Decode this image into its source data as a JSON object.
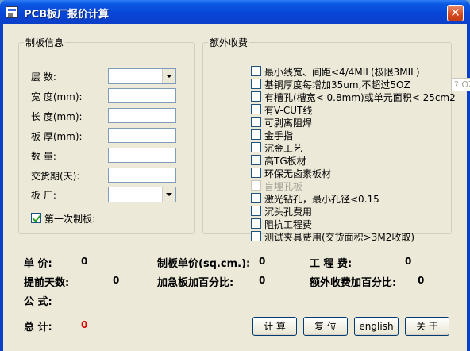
{
  "window": {
    "title": "PCB板厂报价计算",
    "close_label": "✕"
  },
  "board_info": {
    "legend": "制板信息",
    "fields": [
      {
        "label": "层  数:",
        "type": "combo",
        "value": ""
      },
      {
        "label": "宽  度(mm):",
        "type": "text",
        "value": ""
      },
      {
        "label": "长  度(mm):",
        "type": "text",
        "value": ""
      },
      {
        "label": "板  厚(mm):",
        "type": "text",
        "value": ""
      },
      {
        "label": "数  量:",
        "type": "text",
        "value": ""
      },
      {
        "label": "交货期(天):",
        "type": "text",
        "value": ""
      },
      {
        "label": "板  厂:",
        "type": "combo",
        "value": ""
      }
    ],
    "first_order": {
      "label": "第一次制板:",
      "checked": true
    }
  },
  "extra_fees": {
    "legend": "额外收费",
    "items": [
      {
        "label": "最小线宽、间距<4/4MIL(极限3MIL)",
        "checked": false,
        "enabled": true
      },
      {
        "label": "基铜厚度每增加35um,不超过5OZ",
        "checked": false,
        "enabled": true,
        "input_value": "? OZ"
      },
      {
        "label": "有槽孔(槽宽< 0.8mm)或单元面积< 25cm2",
        "checked": false,
        "enabled": true
      },
      {
        "label": "有V-CUT线",
        "checked": false,
        "enabled": true
      },
      {
        "label": "可剥离阻焊",
        "checked": false,
        "enabled": true
      },
      {
        "label": "金手指",
        "checked": false,
        "enabled": true
      },
      {
        "label": "沉金工艺",
        "checked": false,
        "enabled": true
      },
      {
        "label": "高TG板材",
        "checked": false,
        "enabled": true
      },
      {
        "label": "环保无卤素板材",
        "checked": false,
        "enabled": true
      },
      {
        "label": "盲埋孔板",
        "checked": false,
        "enabled": false
      },
      {
        "label": "激光钻孔，最小孔径<0.15",
        "checked": false,
        "enabled": true
      },
      {
        "label": "沉头孔费用",
        "checked": false,
        "enabled": true
      },
      {
        "label": "阻抗工程费",
        "checked": false,
        "enabled": true
      },
      {
        "label": "测试夹具费用(交货面积>3M2收取)",
        "checked": false,
        "enabled": true
      }
    ]
  },
  "results": {
    "unit_price": {
      "label": "单  价:",
      "value": "0"
    },
    "board_unit_price": {
      "label": "制板单价(sq.cm.):",
      "value": "0"
    },
    "engineering_fee": {
      "label": "工 程 费:",
      "value": "0"
    },
    "lead_days": {
      "label": "提前天数:",
      "value": "0"
    },
    "rush_percent": {
      "label": "加急板加百分比:",
      "value": "0"
    },
    "extra_percent": {
      "label": "额外收费加百分比:",
      "value": "0"
    },
    "formula": {
      "label": "公  式:",
      "value": ""
    },
    "total": {
      "label": "总  计:",
      "value": "0",
      "color": "#e00000"
    }
  },
  "buttons": {
    "calculate": "计 算",
    "reset": "复 位",
    "english": "english",
    "about": "关 于"
  }
}
